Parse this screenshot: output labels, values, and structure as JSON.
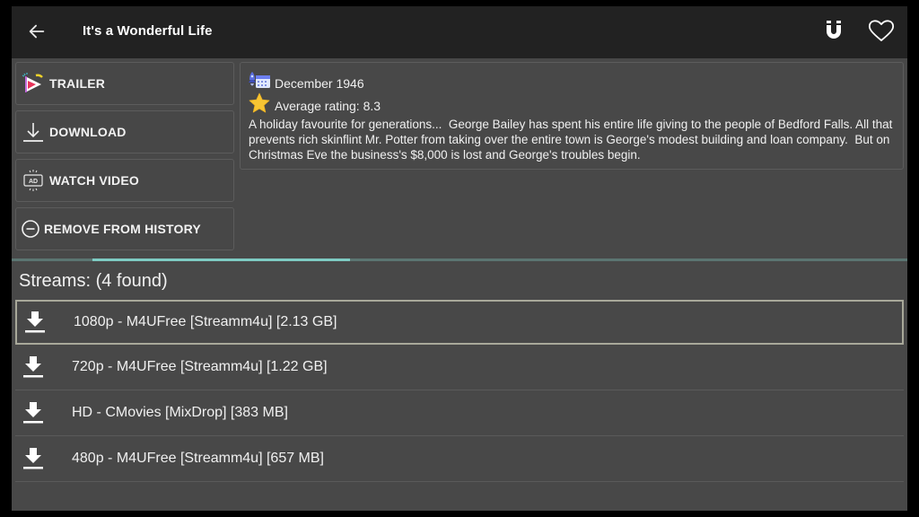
{
  "header": {
    "title": "It's a Wonderful Life",
    "back_icon": "arrow-left-icon",
    "magnet_icon": "magnet-icon",
    "favorite_icon": "heart-outline-icon"
  },
  "actions": [
    {
      "label": "TRAILER",
      "icon": "trailer-play-icon"
    },
    {
      "label": "DOWNLOAD",
      "icon": "download-icon"
    },
    {
      "label": "WATCH VIDEO",
      "icon": "ad-video-icon"
    },
    {
      "label": "REMOVE FROM HISTORY",
      "icon": "minus-circle-icon"
    }
  ],
  "info": {
    "release_date": "December 1946",
    "rating": "Average rating: 8.3",
    "description": "A holiday favourite for generations...  George Bailey has spent his entire life giving to the people of Bedford Falls. All that prevents rich skinflint Mr. Potter from taking over the entire town is George's modest building and loan company.  But on Christmas Eve the business's $8,000 is lost and George's troubles begin."
  },
  "progress": {
    "start_fraction": 0.09,
    "end_fraction": 0.378,
    "fill_color": "#7ecbc3",
    "track_color": "#5b7572"
  },
  "streams": {
    "heading": "Streams: (4 found)",
    "items": [
      {
        "label": "1080p - M4UFree [Streamm4u] [2.13 GB]",
        "selected": true
      },
      {
        "label": "720p - M4UFree [Streamm4u] [1.22 GB]",
        "selected": false
      },
      {
        "label": "HD - CMovies [MixDrop] [383 MB]",
        "selected": false
      },
      {
        "label": "480p - M4UFree [Streamm4u] [657 MB]",
        "selected": false
      }
    ]
  }
}
